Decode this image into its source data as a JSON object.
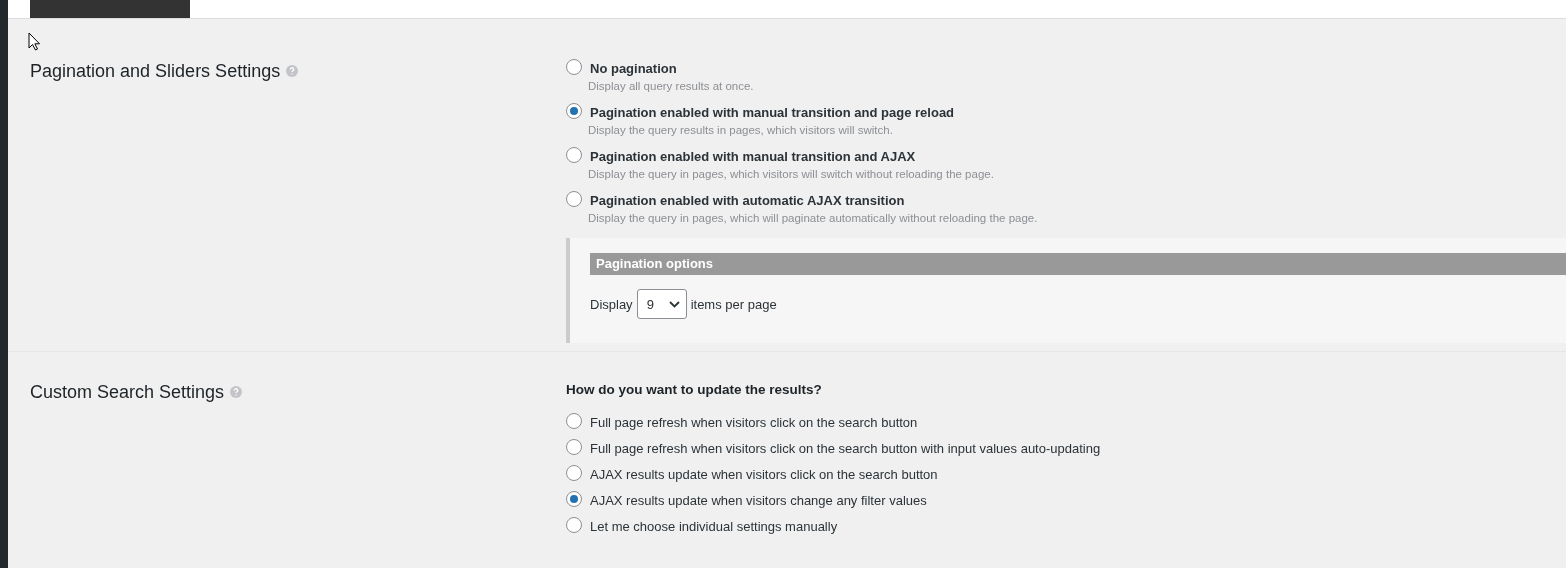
{
  "sections": [
    {
      "kind": "pagination",
      "title": "Pagination and Sliders Settings",
      "options": [
        {
          "label": "No pagination",
          "description": "Display all query results at once.",
          "selected": false
        },
        {
          "label": "Pagination enabled with manual transition and page reload",
          "description": "Display the query results in pages, which visitors will switch.",
          "selected": true
        },
        {
          "label": "Pagination enabled with manual transition and AJAX",
          "description": "Display the query in pages, which visitors will switch without reloading the page.",
          "selected": false
        },
        {
          "label": "Pagination enabled with automatic AJAX transition",
          "description": "Display the query in pages, which will paginate automatically without reloading the page.",
          "selected": false
        }
      ],
      "pagination_options": {
        "title": "Pagination options",
        "prefix": "Display",
        "value": "9",
        "suffix": "items per page"
      }
    },
    {
      "kind": "search",
      "title": "Custom Search Settings",
      "question": "How do you want to update the results?",
      "options": [
        {
          "label": "Full page refresh when visitors click on the search button",
          "selected": false
        },
        {
          "label": "Full page refresh when visitors click on the search button with input values auto-updating",
          "selected": false
        },
        {
          "label": "AJAX results update when visitors click on the search button",
          "selected": false
        },
        {
          "label": "AJAX results update when visitors change any filter values",
          "selected": true
        },
        {
          "label": "Let me choose individual settings manually",
          "selected": false
        }
      ]
    }
  ]
}
